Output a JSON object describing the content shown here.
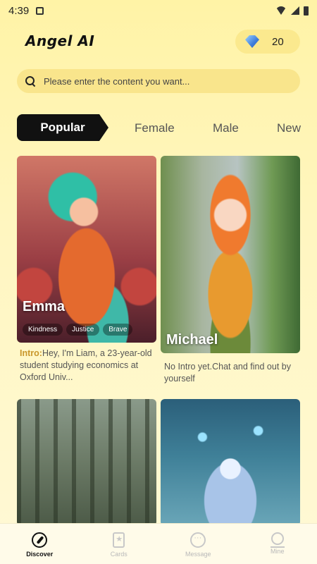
{
  "status_bar": {
    "time": "4:39"
  },
  "header": {
    "app_title": "Angel AI",
    "gem_count": "20"
  },
  "search": {
    "placeholder": "Please enter the content you want..."
  },
  "tabs": [
    {
      "label": "Popular",
      "active": true
    },
    {
      "label": "Female",
      "active": false
    },
    {
      "label": "Male",
      "active": false
    },
    {
      "label": "New",
      "active": false
    }
  ],
  "cards": [
    {
      "name": "Emma",
      "tags": [
        "Kindness",
        "Justice",
        "Brave"
      ],
      "intro_label": "Intro:",
      "intro_text": "Hey, I'm Liam, a 23-year-old student studying economics at Oxford Univ..."
    },
    {
      "name": "Michael",
      "tags": [],
      "intro_label": "",
      "intro_text": "No Intro yet.Chat and find out by yourself"
    },
    {
      "name": "",
      "tags": [],
      "intro_label": "",
      "intro_text": ""
    },
    {
      "name": "",
      "tags": [],
      "intro_label": "",
      "intro_text": ""
    }
  ],
  "bottom_nav": [
    {
      "label": "Discover",
      "icon": "compass-icon",
      "active": true
    },
    {
      "label": "Cards",
      "icon": "cards-icon",
      "active": false
    },
    {
      "label": "Message",
      "icon": "message-icon",
      "active": false
    },
    {
      "label": "Mine",
      "icon": "profile-icon",
      "active": false
    }
  ],
  "colors": {
    "background": "#fff3a6",
    "active_tab": "#111111",
    "intro_label": "#c9962a",
    "search_bg": "#f9e58c"
  }
}
